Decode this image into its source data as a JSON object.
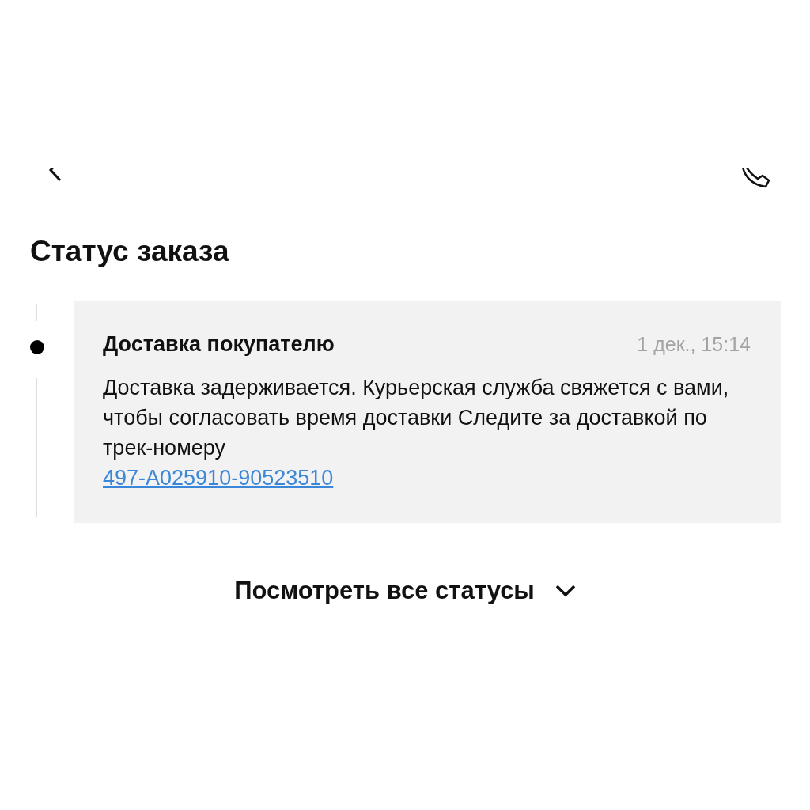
{
  "page_title": "Статус заказа",
  "statuses": [
    {
      "title": "Доставка покупателю",
      "date": "1 дек., 15:14",
      "text": "Доставка задерживается. Курьерская служба свяжется с вами, чтобы согласовать время доставки Следите за доставкой по трек-номеру",
      "tracking_link": "497-A025910-90523510"
    }
  ],
  "show_all_button": "Посмотреть все статусы"
}
